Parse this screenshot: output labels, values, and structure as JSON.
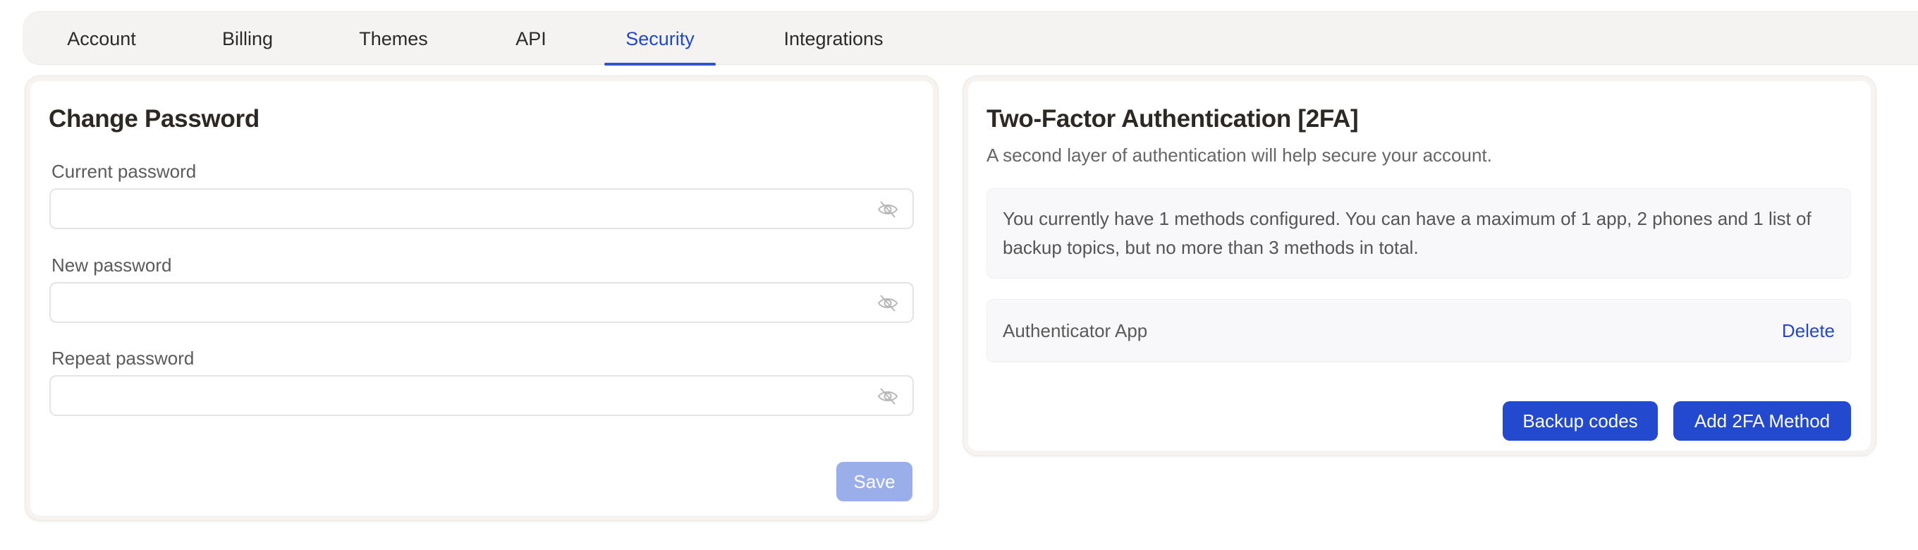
{
  "tabs": [
    {
      "label": "Account"
    },
    {
      "label": "Billing"
    },
    {
      "label": "Themes"
    },
    {
      "label": "API"
    },
    {
      "label": "Security",
      "active": true
    },
    {
      "label": "Integrations"
    }
  ],
  "password_card": {
    "title": "Change Password",
    "current_label": "Current password",
    "current_value": "",
    "new_label": "New password",
    "new_value": "",
    "repeat_label": "Repeat password",
    "repeat_value": "",
    "eye_icon": "eye-off-icon",
    "save_label": "Save"
  },
  "twofa_card": {
    "title": "Two-Factor Authentication [2FA]",
    "subtitle": "A second layer of authentication will help secure your account.",
    "info": "You currently have 1 methods configured. You can have a maximum of 1 app, 2 phones and 1 list of backup topics, but no more than 3 methods in total.",
    "methods": [
      {
        "name": "Authenticator App",
        "action": "Delete"
      }
    ],
    "backup_label": "Backup codes",
    "add_label": "Add 2FA Method"
  },
  "colors": {
    "accent": "#2349cf",
    "accent_disabled": "#9aaeea",
    "tabbar_bg": "#f4f3f2"
  }
}
